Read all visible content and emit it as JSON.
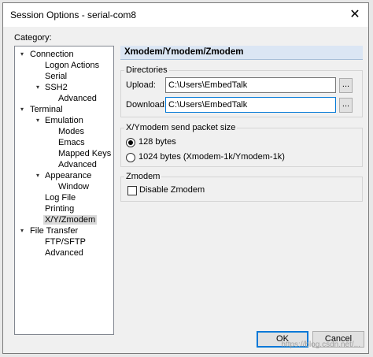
{
  "window": {
    "title": "Session Options - serial-com8",
    "close_glyph": "✕"
  },
  "category_label": "Category:",
  "tree": [
    {
      "label": "Connection",
      "twisty": "▾"
    },
    {
      "label": "Logon Actions"
    },
    {
      "label": "Serial"
    },
    {
      "label": "SSH2",
      "twisty": "▾"
    },
    {
      "label": "Advanced"
    },
    {
      "label": "Terminal",
      "twisty": "▾"
    },
    {
      "label": "Emulation",
      "twisty": "▾"
    },
    {
      "label": "Modes"
    },
    {
      "label": "Emacs"
    },
    {
      "label": "Mapped Keys"
    },
    {
      "label": "Advanced"
    },
    {
      "label": "Appearance",
      "twisty": "▾"
    },
    {
      "label": "Window"
    },
    {
      "label": "Log File"
    },
    {
      "label": "Printing"
    },
    {
      "label": "X/Y/Zmodem",
      "selected": true
    },
    {
      "label": "File Transfer",
      "twisty": "▾"
    },
    {
      "label": "FTP/SFTP"
    },
    {
      "label": "Advanced"
    }
  ],
  "panel": {
    "header": "Xmodem/Ymodem/Zmodem",
    "directories": {
      "title": "Directories",
      "upload_label": "Upload:",
      "upload_value": "C:\\Users\\EmbedTalk",
      "download_label": "Download:",
      "download_value": "C:\\Users\\EmbedTalk",
      "browse_label": "..."
    },
    "packet": {
      "title": "X/Ymodem send packet size",
      "opt1": "128 bytes",
      "opt2": "1024 bytes  (Xmodem-1k/Ymodem-1k)",
      "selected": "128 bytes"
    },
    "zmodem": {
      "title": "Zmodem",
      "disable_label": "Disable Zmodem",
      "disabled": false
    }
  },
  "buttons": {
    "ok": "OK",
    "cancel": "Cancel"
  },
  "watermark": "https://blog.csdn.net/..."
}
